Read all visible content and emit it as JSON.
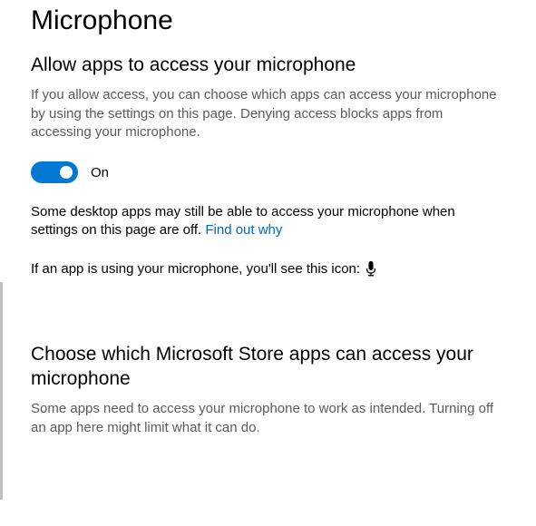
{
  "page": {
    "title": "Microphone"
  },
  "section1": {
    "heading": "Allow apps to access your microphone",
    "description": "If you allow access, you can choose which apps can access your microphone by using the settings on this page. Denying access blocks apps from accessing your microphone.",
    "toggle": {
      "state": "On"
    },
    "desktop_note_prefix": "Some desktop apps may still be able to access your microphone when settings on this page are off. ",
    "desktop_note_link": "Find out why",
    "icon_note": "If an app is using your microphone, you'll see this icon:"
  },
  "section2": {
    "heading": "Choose which Microsoft Store apps can access your microphone",
    "description": "Some apps need to access your microphone to work as intended. Turning off an app here might limit what it can do."
  }
}
